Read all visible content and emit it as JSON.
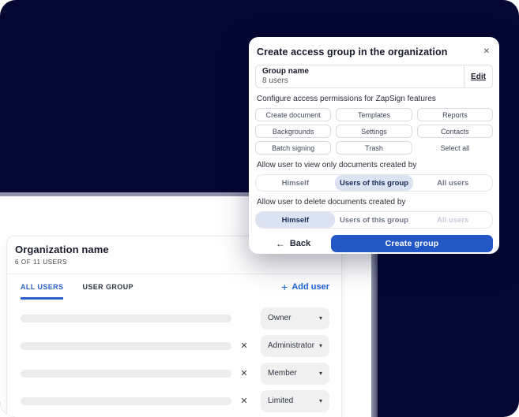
{
  "colors": {
    "navy": "#030732",
    "accent_blue": "#2257c5",
    "link_blue": "#1a62d9",
    "selected_segment_bg": "#dbe2f2",
    "selected_segment_text": "#1b2c58"
  },
  "modal": {
    "title": "Create access group in the organization",
    "close_icon": "✕",
    "group_box": {
      "label": "Group name",
      "value": "8 users",
      "edit_label": "Edit"
    },
    "configure_label": "Configure access permissions for ZapSign features",
    "permissions": [
      "Create document",
      "Templates",
      "Reports",
      "Backgrounds",
      "Settings",
      "Contacts",
      "Batch signing",
      "Trash"
    ],
    "select_all_label": "Select all",
    "view_section": {
      "label": "Allow user to view only documents created by",
      "options": [
        "Himself",
        "Users of this group",
        "All users"
      ],
      "selected": "Users of this group"
    },
    "delete_section": {
      "label": "Allow user to delete documents created by",
      "options": [
        "Himself",
        "Users of this group",
        "All users"
      ],
      "selected": "Himself",
      "disabled_option": "All users"
    },
    "footer": {
      "back_arrow": "←",
      "back_label": "Back",
      "submit_label": "Create group"
    }
  },
  "panel": {
    "title": "Organization name",
    "subtitle": "6 OF 11 USERS",
    "tabs": [
      {
        "label": "ALL USERS",
        "active": true
      },
      {
        "label": "USER GROUP",
        "active": false
      }
    ],
    "add_user": {
      "plus_icon": "+",
      "label": "Add user"
    },
    "remove_icon": "✕",
    "caret_icon": "▾",
    "rows": [
      {
        "role": "Owner",
        "removable": false
      },
      {
        "role": "Administrator",
        "removable": true
      },
      {
        "role": "Member",
        "removable": true
      },
      {
        "role": "Limited",
        "removable": true
      }
    ]
  }
}
